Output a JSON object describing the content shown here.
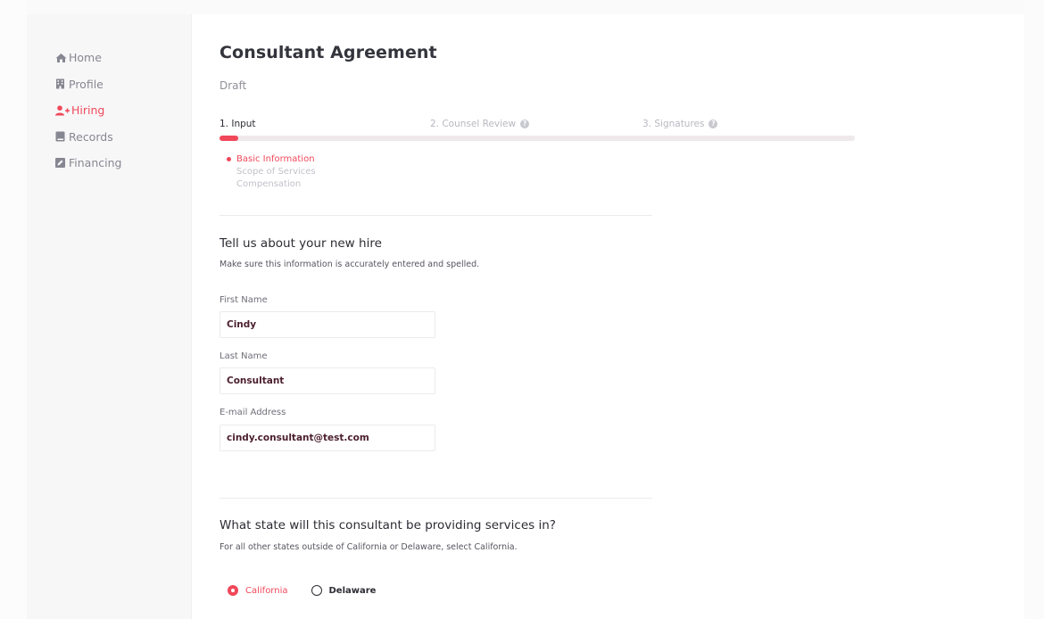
{
  "sidebar": {
    "items": [
      {
        "label": "Home",
        "icon": "home-icon"
      },
      {
        "label": "Profile",
        "icon": "building-icon"
      },
      {
        "label": "Hiring",
        "icon": "user-plus-icon",
        "active": true
      },
      {
        "label": "Records",
        "icon": "book-icon"
      },
      {
        "label": "Financing",
        "icon": "edit-icon"
      }
    ]
  },
  "page": {
    "title": "Consultant Agreement",
    "status": "Draft"
  },
  "steps": [
    {
      "label": "1. Input",
      "current": true
    },
    {
      "label": "2. Counsel Review",
      "help": true
    },
    {
      "label": "3. Signatures",
      "help": true
    }
  ],
  "progress": {
    "fraction": 0.03
  },
  "substeps": [
    {
      "label": "Basic Information",
      "active": true
    },
    {
      "label": "Scope of Services"
    },
    {
      "label": "Compensation"
    }
  ],
  "new_hire": {
    "title": "Tell us about your new hire",
    "subtitle": "Make sure this information is accurately entered and spelled.",
    "fields": [
      {
        "label": "First Name",
        "value": "Cindy"
      },
      {
        "label": "Last Name",
        "value": "Consultant"
      },
      {
        "label": "E-mail Address",
        "value": "cindy.consultant@test.com"
      }
    ]
  },
  "state": {
    "title": "What state will this consultant be providing services in?",
    "subtitle": "For all other states outside of California or Delaware, select California.",
    "options": [
      {
        "label": "California",
        "selected": true
      },
      {
        "label": "Delaware",
        "selected": false
      }
    ]
  },
  "colors": {
    "accent": "#f0485a",
    "text": "#2c2c34",
    "muted": "#878792"
  }
}
